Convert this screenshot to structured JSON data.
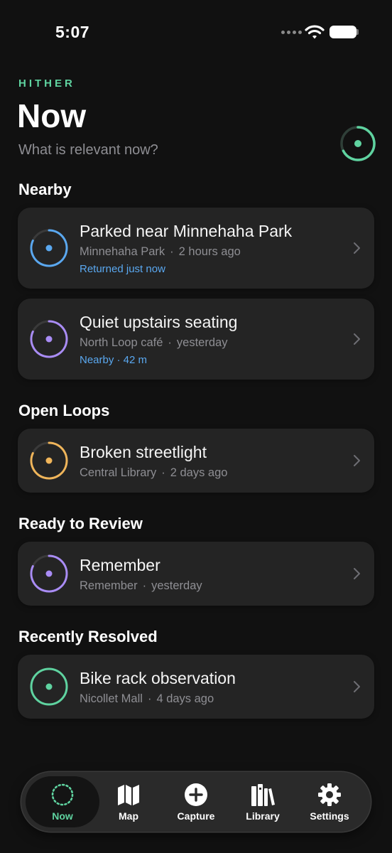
{
  "status_bar": {
    "time": "5:07"
  },
  "header": {
    "brand": "HITHER",
    "title": "Now",
    "subtitle": "What is relevant now?"
  },
  "sections": {
    "nearby": "Nearby",
    "open_loops": "Open Loops",
    "ready_to_review": "Ready to Review",
    "recently_resolved": "Recently Resolved"
  },
  "cards": [
    {
      "title": "Parked near Minnehaha Park",
      "place": "Minnehaha Park",
      "when": "2 hours ago",
      "status": "Returned just now",
      "ring_color": "#5aa8f0"
    },
    {
      "title": "Quiet upstairs seating",
      "place": "North Loop café",
      "when": "yesterday",
      "status": "Nearby · 42 m",
      "ring_color": "#a98cf5"
    },
    {
      "title": "Broken streetlight",
      "place": "Central Library",
      "when": "2 days ago",
      "ring_color": "#f0b55a"
    },
    {
      "title": "Remember",
      "place": "Remember",
      "when": "yesterday",
      "ring_color": "#a98cf5"
    },
    {
      "title": "Bike rack observation",
      "place": "Nicollet Mall",
      "when": "4 days ago",
      "ring_color": "#5fd3a0"
    }
  ],
  "meta_separator": "·",
  "tabs": [
    {
      "label": "Now",
      "icon": "dotted-circle-icon",
      "active": true
    },
    {
      "label": "Map",
      "icon": "map-icon"
    },
    {
      "label": "Capture",
      "icon": "plus-circle-icon"
    },
    {
      "label": "Library",
      "icon": "books-icon"
    },
    {
      "label": "Settings",
      "icon": "gear-icon"
    }
  ],
  "colors": {
    "accent": "#5fd3a0",
    "background": "#111111",
    "card": "#242424",
    "link_blue": "#5aa8f0"
  }
}
